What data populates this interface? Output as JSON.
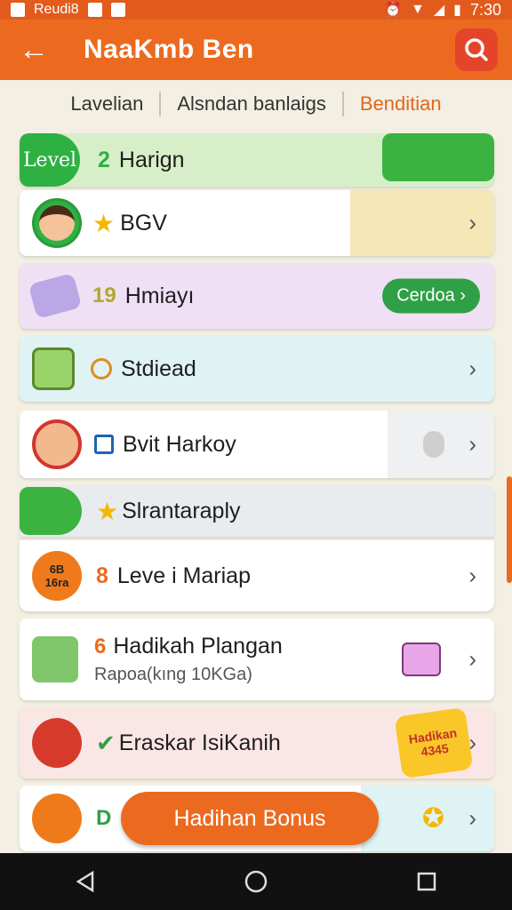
{
  "statusbar": {
    "carrier": "Reudi8",
    "time": "7:30"
  },
  "appbar": {
    "title": "NaaKmb Ben",
    "back_icon": "arrow-left-icon",
    "search_icon": "search-icon"
  },
  "tabs": [
    {
      "label": "Lavelian",
      "active": false
    },
    {
      "label": "Alsndan banlaigs",
      "active": false
    },
    {
      "label": "Benditian",
      "active": true
    }
  ],
  "level_header": {
    "badge": "Level",
    "number": "2",
    "title": "Harign"
  },
  "rows": [
    {
      "prefix": "★",
      "label": "BGV"
    },
    {
      "prefix": "19",
      "label": "Hmiayı",
      "action": "Cerdoa ›"
    },
    {
      "prefix": "0",
      "label": "Stdiead"
    },
    {
      "prefix": "▤",
      "label": "Bvit Harkoy"
    },
    {
      "prefix": "★",
      "label": "Slrantaraply"
    },
    {
      "prefix": "8",
      "label": "Leve i Mariap",
      "icon_text": "6B 16ra"
    },
    {
      "prefix": "6",
      "label": "Hadikah Plangan",
      "sublabel": "Rapoa(kıng 10KGa)"
    },
    {
      "prefix": "✔",
      "label": "Eraskar IsiKanih",
      "badge": "Hadikan 4345"
    },
    {
      "prefix": "D",
      "label": "Hadihan Bonus"
    }
  ],
  "colors": {
    "accent": "#ec6a1f",
    "green": "#2fb043",
    "purple": "#efe0f5",
    "teal": "#dff3f4"
  }
}
